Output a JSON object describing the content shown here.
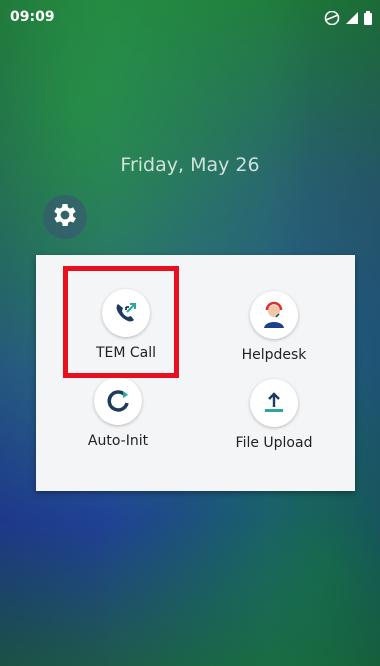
{
  "status_bar": {
    "time": "09:09",
    "icons": [
      "wifi-icon",
      "signal-icon",
      "battery-icon"
    ]
  },
  "lock_screen": {
    "date": "Friday, May 26"
  },
  "settings": {
    "icon": "gear-icon"
  },
  "shortcuts": [
    {
      "label": "TEM Call",
      "icon": "phone-call-icon"
    },
    {
      "label": "Helpdesk",
      "icon": "helpdesk-agent-icon"
    },
    {
      "label": "Auto-Init",
      "icon": "refresh-icon"
    },
    {
      "label": "File Upload",
      "icon": "upload-icon"
    }
  ],
  "highlight": {
    "target": "TEM Call",
    "color": "#e8101f"
  }
}
